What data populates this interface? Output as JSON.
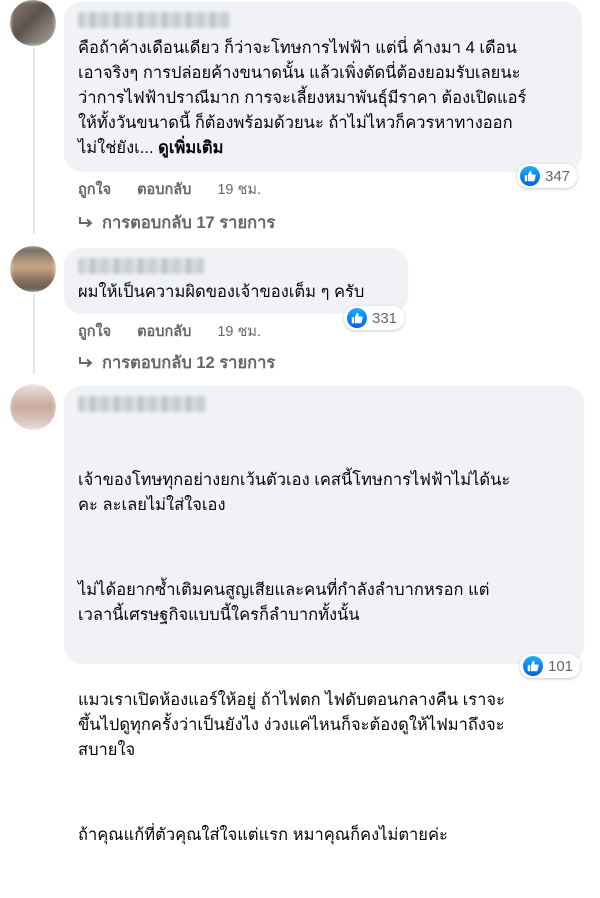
{
  "comments": [
    {
      "text": "คือถ้าค้างเดือนเดียว ก็ว่าจะโทษการไฟฟ้า แต่นี่ ค้างมา 4 เดือน\nเอาจริงๆ การปล่อยค้างขนาดนั้น แล้วเพิ่งตัดนี่ต้องยอมรับเลยนะ\nว่าการไฟฟ้าปราณีมาก การจะเลี้ยงหมาพันธุ์มีราคา ต้องเปิดแอร์\nให้ทั้งวันขนาดนี้ ก็ต้องพร้อมด้วยนะ ถ้าไม่ไหวก็ควรหาทางออก\nไม่ใช่ยังเ... ",
      "see_more": "ดูเพิ่มเติม",
      "like_label": "ถูกใจ",
      "reply_label": "ตอบกลับ",
      "time": "19 ชม.",
      "reaction_count": "347",
      "replies_label": "การตอบกลับ 17 รายการ"
    },
    {
      "text": "ผมให้เป็นความผิดของเจ้าของเต็ม ๆ ครับ",
      "like_label": "ถูกใจ",
      "reply_label": "ตอบกลับ",
      "time": "19 ชม.",
      "reaction_count": "331",
      "replies_label": "การตอบกลับ 12 รายการ"
    },
    {
      "paragraphs": [
        "เจ้าของโทษทุกอย่างยกเว้นตัวเอง เคสนี้โทษการไฟฟ้าไม่ได้นะ\nคะ ละเลยไม่ใส่ใจเอง",
        "ไม่ได้อยากซ้ำเติมคนสูญเสียและคนที่กำลังลำบากหรอก แต่\nเวลานี้เศรษฐกิจแบบนี้ใครก็ลำบากทั้งนั้น",
        "แมวเราเปิดห้องแอร์ให้อยู่ ถ้าไฟตก ไฟดับตอนกลางคืน เราจะ\nขึ้นไปดูทุกครั้งว่าเป็นยังไง ง่วงแค่ไหนก็จะต้องดูให้ไฟมาถึงจะ\nสบายใจ",
        "ถ้าคุณแก้ที่ตัวคุณใส่ใจแต่แรก หมาคุณก็คงไม่ตายค่ะ"
      ],
      "reaction_count": "101"
    }
  ],
  "colors": {
    "bubble": "#f0f2f5",
    "meta": "#65676b",
    "like": "#1877f2"
  }
}
